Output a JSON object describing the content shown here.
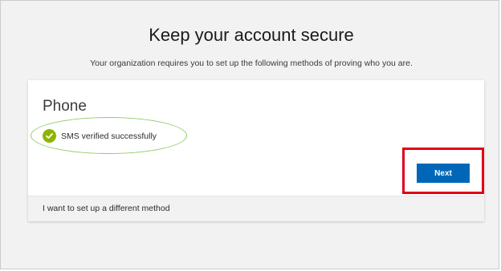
{
  "header": {
    "title": "Keep your account secure",
    "subtitle": "Your organization requires you to set up the following methods of proving who you are."
  },
  "card": {
    "heading": "Phone",
    "status_text": "SMS verified successfully",
    "next_label": "Next",
    "footer_link": "I want to set up a different method"
  },
  "colors": {
    "accent": "#0067b8",
    "success": "#8db500",
    "annotation_ellipse": "#8ccf6a",
    "annotation_box": "#e1001a"
  }
}
